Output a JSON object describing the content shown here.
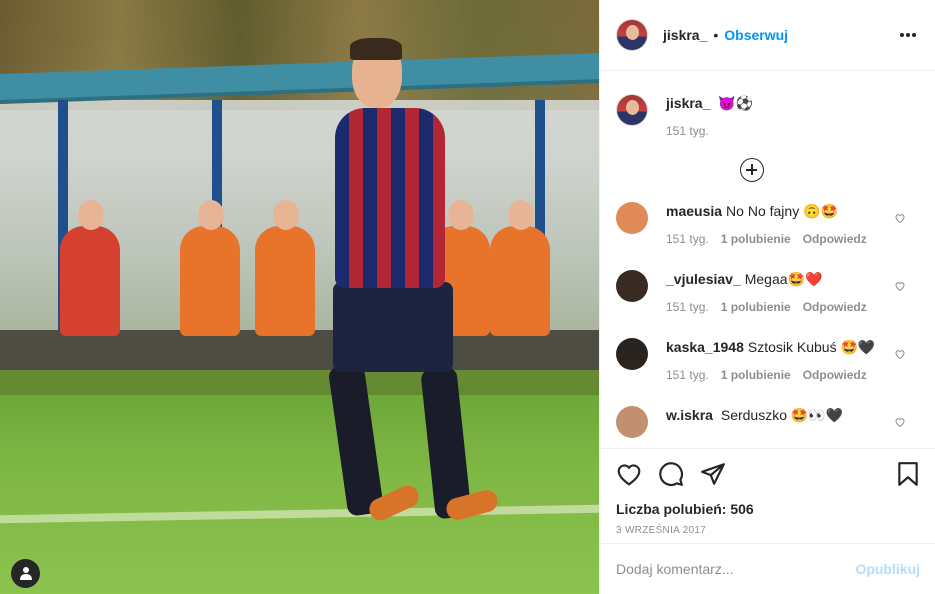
{
  "post": {
    "author": "jiskra_",
    "follow_label": "Obserwuj",
    "separator": "•"
  },
  "caption": {
    "author": "jiskra_",
    "text": "😈⚽",
    "time": "151 tyg."
  },
  "comments": [
    {
      "user": "maeusia",
      "text": "No No fajny 🙃🤩",
      "time": "151 tyg.",
      "likes": "1 polubienie",
      "reply": "Odpowiedz",
      "avatar_color": "#e08a5a"
    },
    {
      "user": "_vjulesiav_",
      "text": "Megaa🤩❤️",
      "time": "151 tyg.",
      "likes": "1 polubienie",
      "reply": "Odpowiedz",
      "avatar_color": "#3a2a24"
    },
    {
      "user": "kaska_1948",
      "text": "Sztosik Kubuś 🤩🖤",
      "time": "151 tyg.",
      "likes": "1 polubienie",
      "reply": "Odpowiedz",
      "avatar_color": "#2a2420"
    },
    {
      "user": "w.iskra",
      "text": " Serduszko 🤩👀🖤",
      "time": "",
      "likes": "",
      "reply": "",
      "avatar_color": "#c09070"
    }
  ],
  "actions": {
    "likes_text": "Liczba polubień: 506",
    "date": "3 WRZEŚNIA 2017"
  },
  "composer": {
    "placeholder": "Dodaj komentarz...",
    "post_label": "Opublikuj"
  },
  "icons": [
    "more-options-icon",
    "load-more-icon",
    "heart-icon",
    "comment-icon",
    "share-icon",
    "bookmark-icon",
    "user-tag-icon"
  ]
}
